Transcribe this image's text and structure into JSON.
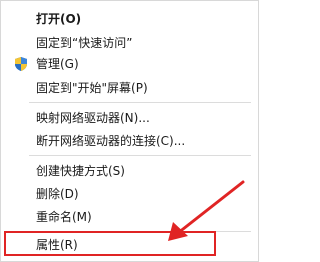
{
  "context_menu": {
    "items": [
      {
        "label": "打开(O)"
      },
      {
        "label": "固定到“快速访问”"
      },
      {
        "label": "管理(G)",
        "icon": "uac-shield-icon"
      },
      {
        "label": "固定到\"开始\"屏幕(P)"
      },
      {
        "label": "映射网络驱动器(N)..."
      },
      {
        "label": "断开网络驱动器的连接(C)..."
      },
      {
        "label": "创建快捷方式(S)"
      },
      {
        "label": "删除(D)"
      },
      {
        "label": "重命名(M)"
      },
      {
        "label": "属性(R)"
      }
    ]
  },
  "annotation": {
    "highlight_color": "#e02424",
    "target": "属性(R)"
  }
}
